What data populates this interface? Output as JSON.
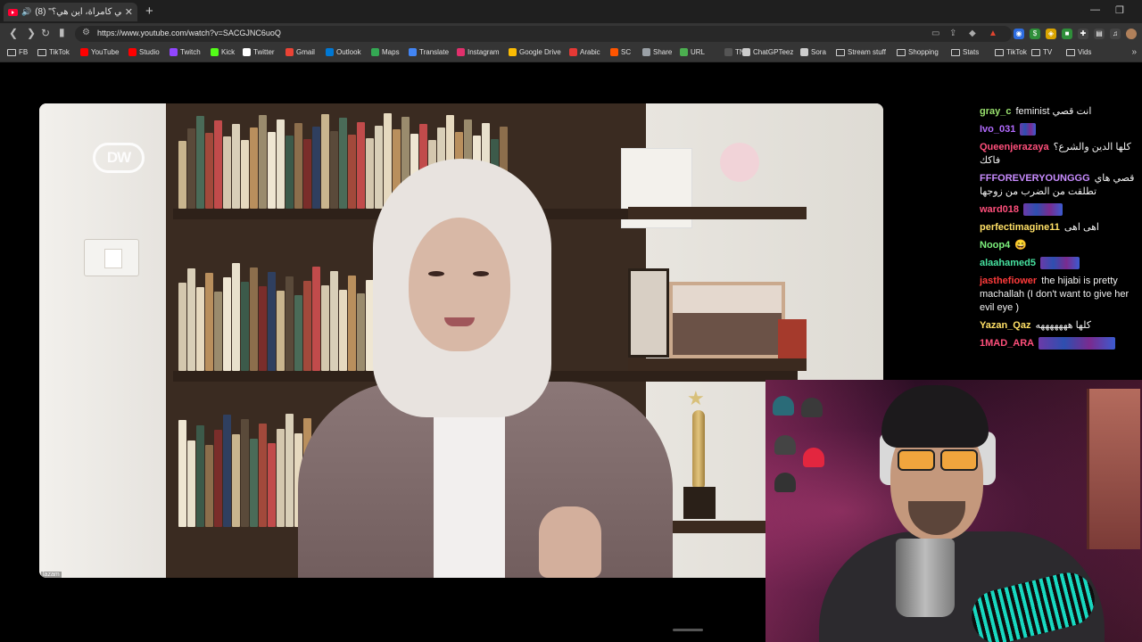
{
  "browser": {
    "tab_title": "(8) \"حقوقي كامرأة، أين هي؟\" |",
    "new_tab": "+",
    "tab_close": "✕",
    "url": "https://www.youtube.com/watch?v=SACGJNC6uoQ",
    "window_controls": {
      "minimize": "—",
      "maximize": "❐"
    }
  },
  "bookmarks": [
    {
      "label": "FB",
      "icon": "folder-icon"
    },
    {
      "label": "TikTok",
      "icon": "folder-icon"
    },
    {
      "label": "YouTube",
      "icon": "youtube-icon",
      "color": "#ff0000"
    },
    {
      "label": "Studio",
      "icon": "youtube-studio-icon",
      "color": "#ff0000"
    },
    {
      "label": "Twitch",
      "icon": "twitch-icon",
      "color": "#9146ff"
    },
    {
      "label": "Kick",
      "icon": "kick-icon",
      "color": "#53fc18"
    },
    {
      "label": "Twitter",
      "icon": "x-icon",
      "color": "#ffffff"
    },
    {
      "label": "Gmail",
      "icon": "gmail-icon",
      "color": "#ea4335"
    },
    {
      "label": "Outlook",
      "icon": "outlook-icon",
      "color": "#0078d4"
    },
    {
      "label": "Maps",
      "icon": "maps-icon",
      "color": "#34a853"
    },
    {
      "label": "Translate",
      "icon": "translate-icon",
      "color": "#4285f4"
    },
    {
      "label": "Instagram",
      "icon": "instagram-icon",
      "color": "#e1306c"
    },
    {
      "label": "Google Drive",
      "icon": "drive-icon",
      "color": "#fbbc04"
    },
    {
      "label": "Arabic",
      "icon": "arabic-icon",
      "color": "#e53935"
    },
    {
      "label": "SC",
      "icon": "soundcloud-icon",
      "color": "#ff5500"
    },
    {
      "label": "Share",
      "icon": "share-icon",
      "color": "#9aa0a6"
    },
    {
      "label": "URL",
      "icon": "url-icon",
      "color": "#4caf50"
    },
    {
      "label": "TN",
      "icon": "tn-icon",
      "color": "#555555"
    },
    {
      "label": "ChatGPTeez",
      "icon": "chatgpt-icon",
      "color": "#cccccc"
    },
    {
      "label": "Sora",
      "icon": "sora-icon",
      "color": "#cccccc"
    },
    {
      "label": "Stream stuff",
      "icon": "folder-icon"
    },
    {
      "label": "Shopping",
      "icon": "folder-icon"
    },
    {
      "label": "Stats",
      "icon": "folder-icon"
    },
    {
      "label": "TikTok",
      "icon": "folder-icon"
    },
    {
      "label": "TV",
      "icon": "folder-icon"
    },
    {
      "label": "Vids",
      "icon": "folder-icon"
    }
  ],
  "video": {
    "logo_text": "DW",
    "caption_tag": "lazam"
  },
  "chat": [
    {
      "user": "gray_c",
      "color": "#9be36f",
      "text": "feminist انت قصي"
    },
    {
      "user": "Ivo_031",
      "color": "#b36bff",
      "text": "",
      "emote": "emote-icon"
    },
    {
      "user": "Queenjerazaya",
      "color": "#ff4f7b",
      "text": "كلها الدين والشرع؟ فاكك"
    },
    {
      "user": "FFFOREVERYOUNGGG",
      "color": "#c98cff",
      "text": "قصي هاي تطلقت من الضرب من زوجها"
    },
    {
      "user": "ward018",
      "color": "#ff4f7b",
      "text": "",
      "emote": "emote-icon"
    },
    {
      "user": "perfectimagine11",
      "color": "#ffe066",
      "text": "اهى اهى"
    },
    {
      "user": "Noop4",
      "color": "#7cf07c",
      "text": "😄"
    },
    {
      "user": "alaahamed5",
      "color": "#47e2a0",
      "text": "",
      "emote": "emote-icon"
    },
    {
      "user": "jasthefiower",
      "color": "#ff3b3b",
      "text": "the hijabi is pretty machallah (I don't want to give her evil eye )"
    },
    {
      "user": "Yazan_Qaz",
      "color": "#ffe066",
      "text": "كلها هههههههه"
    },
    {
      "user": "1MAD_ARA",
      "color": "#ff4f7b",
      "text": "",
      "emote": "emote-icon"
    }
  ]
}
